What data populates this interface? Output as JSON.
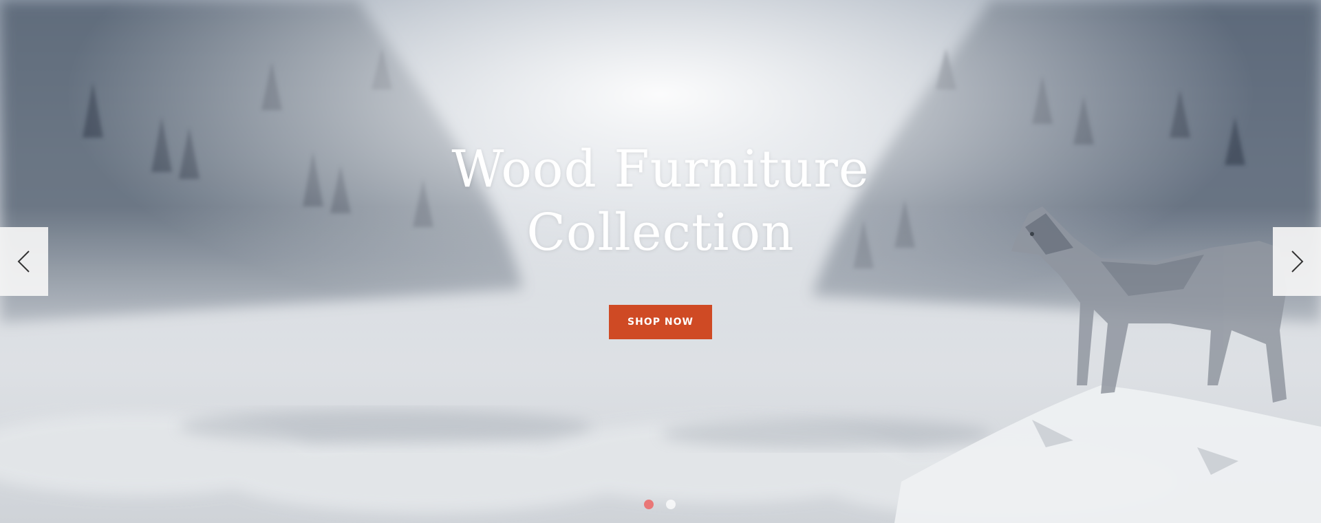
{
  "hero": {
    "title_line1": "Wood Furniture",
    "title_line2": "Collection",
    "cta_label": "SHOP NOW"
  },
  "slider": {
    "prev_icon": "chevron-left-icon",
    "next_icon": "chevron-right-icon",
    "slide_count": 2,
    "active_slide": 1
  },
  "colors": {
    "cta_background": "#cf4a24",
    "title_text": "#ffffff",
    "dot_active": "#e97777",
    "dot_inactive": "#e6e6e6",
    "arrow_background": "#f5f5f5"
  }
}
